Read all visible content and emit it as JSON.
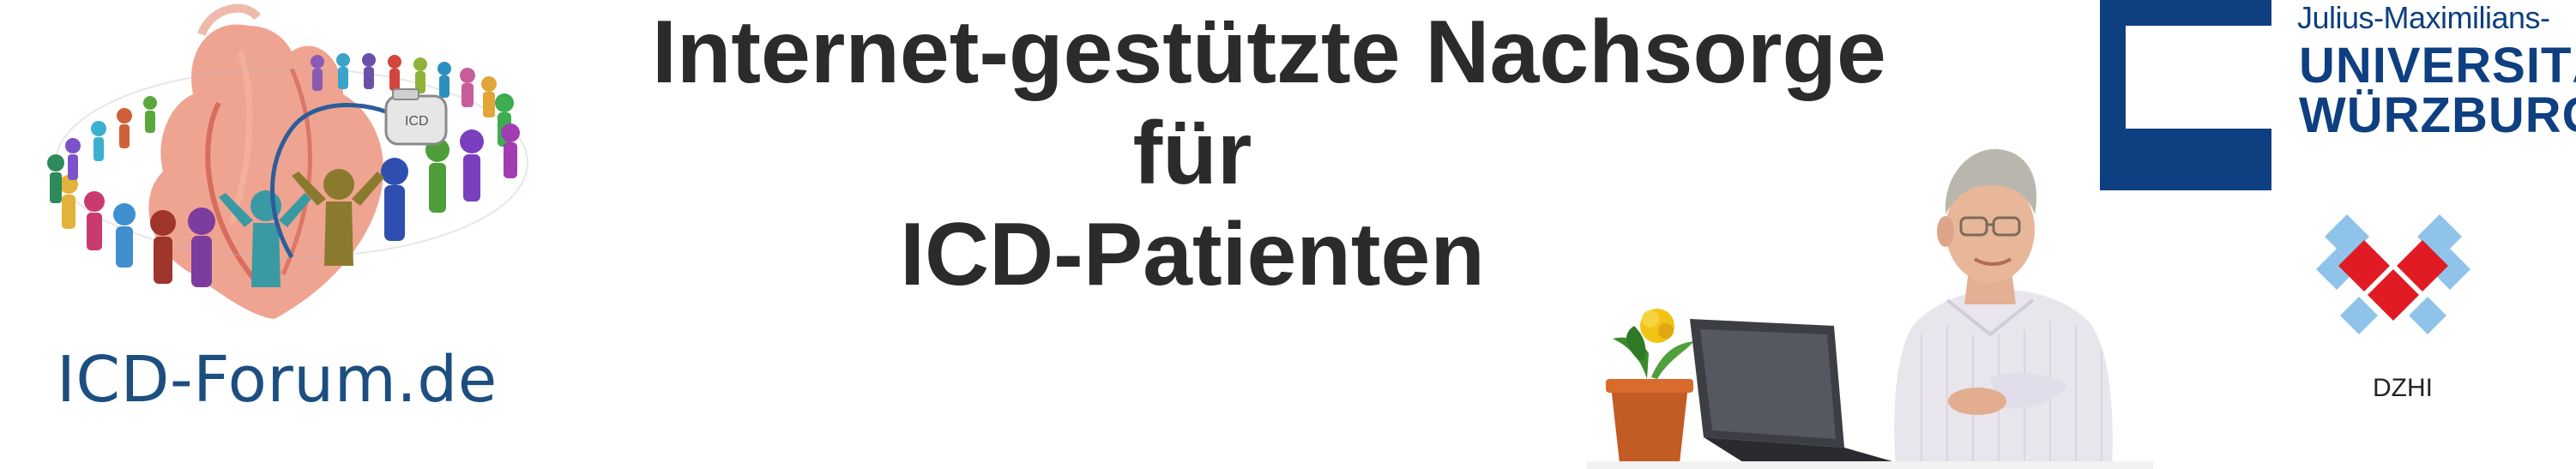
{
  "site": {
    "name": "ICD-Forum.de"
  },
  "headline": {
    "line1": "Internet-gestützte Nachsorge",
    "line2": "für",
    "line3": "ICD-Patienten"
  },
  "university": {
    "line_small": "Julius-Maximilians-",
    "line_big1": "UNIVERSITÄT",
    "line_big2": "WÜRZBURG",
    "color": "#0e3f80"
  },
  "device_label": "ICD",
  "dzhi": {
    "label": "DZHI",
    "colors": {
      "red": "#e01b24",
      "blue": "#8fc3ea"
    }
  },
  "icons": [
    "heart-illustration",
    "people-ring-icon",
    "icd-device-icon",
    "flower-pot-icon",
    "laptop-icon",
    "man-photo"
  ]
}
